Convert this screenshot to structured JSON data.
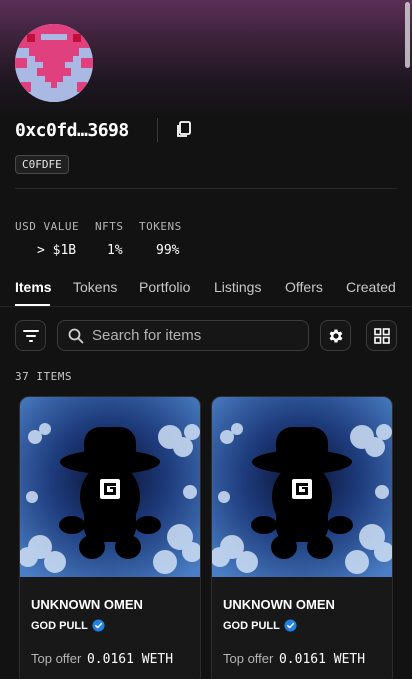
{
  "profile": {
    "address": "0xc0fd…3698",
    "badge": "C0FDFE"
  },
  "stats": [
    {
      "label": "USD VALUE",
      "value": "> $1B"
    },
    {
      "label": "NFTS",
      "value": "1%"
    },
    {
      "label": "TOKENS",
      "value": "99%"
    }
  ],
  "tabs": [
    "Items",
    "Tokens",
    "Portfolio",
    "Listings",
    "Offers",
    "Created"
  ],
  "search": {
    "placeholder": "Search for items"
  },
  "items_count": "37 ITEMS",
  "cards": [
    {
      "name": "UNKNOWN OMEN",
      "collection": "GOD PULL",
      "offer_label": "Top offer",
      "offer_value": "0.0161 WETH"
    },
    {
      "name": "UNKNOWN OMEN",
      "collection": "GOD PULL",
      "offer_label": "Top offer",
      "offer_value": "0.0161 WETH"
    }
  ],
  "colors": {
    "background": "#121212",
    "header_gradient": "#5a2e57",
    "verified": "#2081e2"
  }
}
